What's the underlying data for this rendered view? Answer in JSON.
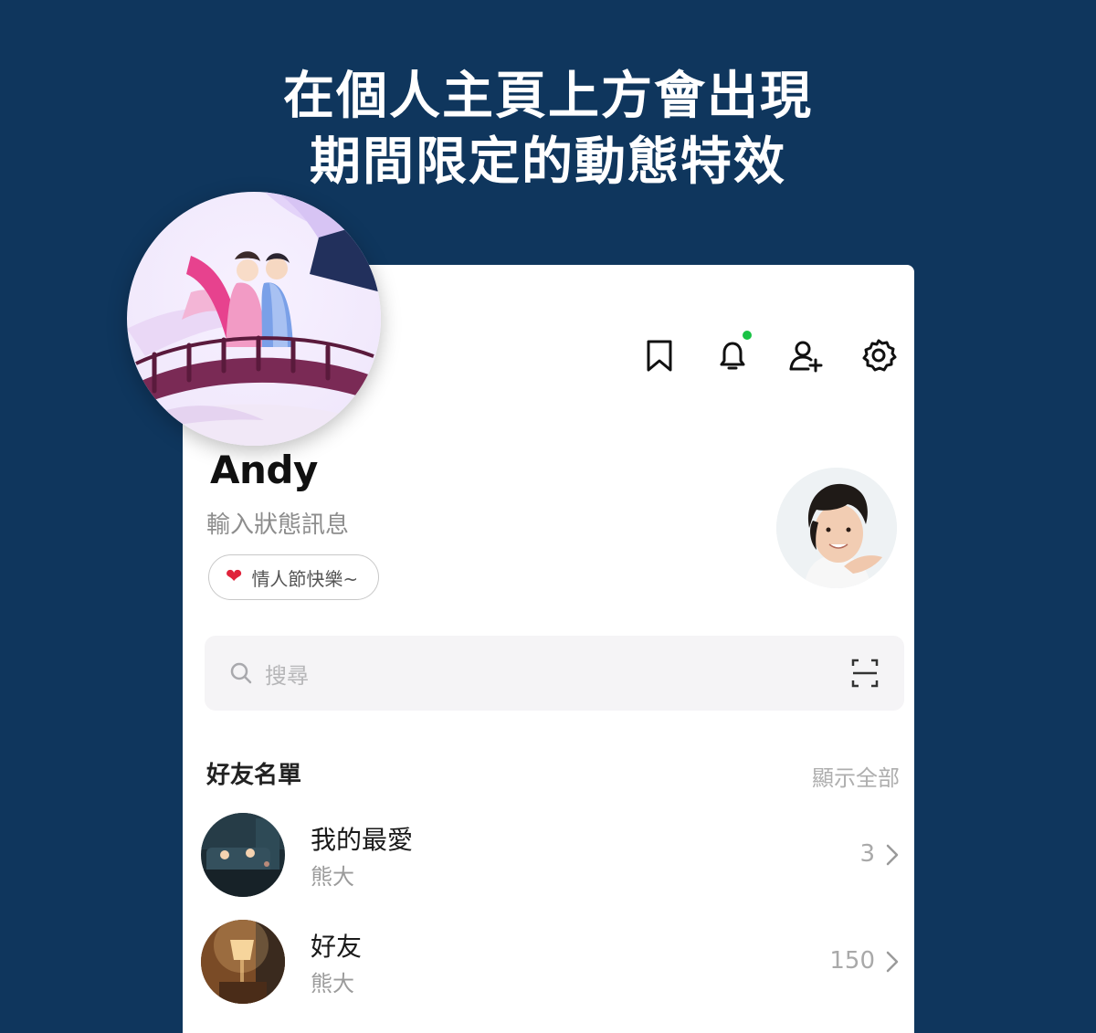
{
  "headline": {
    "line1": "在個人主頁上方會出現",
    "line2": "期間限定的動態特效"
  },
  "topbar": {
    "icons": [
      "bookmark-icon",
      "bell-icon",
      "add-friend-icon",
      "settings-icon"
    ],
    "notification_dot_color": "#19c245"
  },
  "profile": {
    "name": "Andy",
    "status_placeholder": "輸入狀態訊息",
    "chip": {
      "icon": "heart-emoji",
      "text": "情人節快樂~"
    }
  },
  "search": {
    "placeholder": "搜尋",
    "scan_icon": "scan-icon"
  },
  "friends_section": {
    "title": "好友名單",
    "show_all": "顯示全部",
    "rows": [
      {
        "title": "我的最愛",
        "subtitle": "熊大",
        "count": "3"
      },
      {
        "title": "好友",
        "subtitle": "熊大",
        "count": "150"
      }
    ]
  },
  "colors": {
    "background": "#0f365d",
    "card": "#ffffff",
    "accent_green": "#19c245",
    "heart_red": "#e0233b"
  }
}
